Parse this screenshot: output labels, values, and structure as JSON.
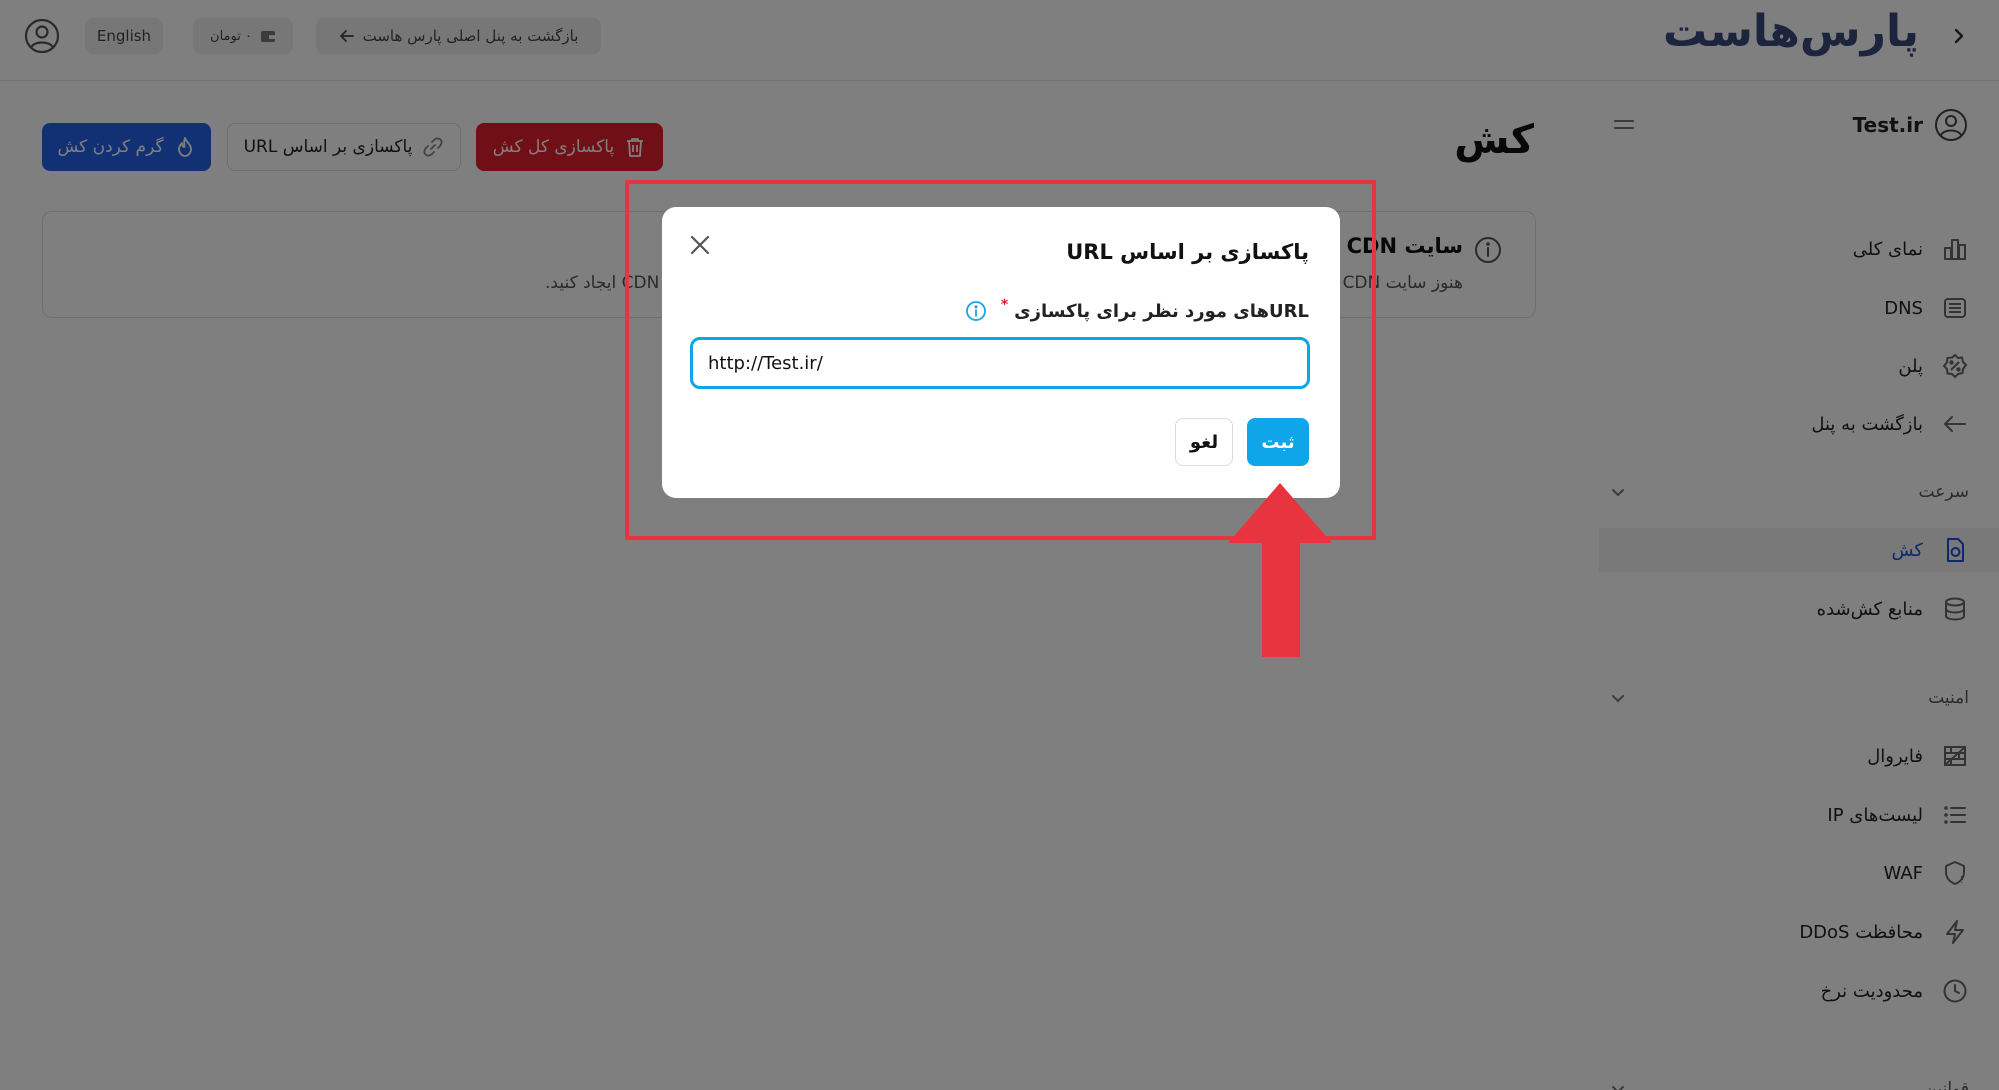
{
  "header": {
    "logo_text": "پارس‌هاست",
    "language_label": "English",
    "balance_label": "۰ تومان",
    "back_to_main_panel": "بازگشت به پنل اصلی پارس هاست"
  },
  "sidebar": {
    "user_domain": "Test.ir",
    "items": [
      {
        "label": "نمای کلی",
        "icon": "chart-icon"
      },
      {
        "label": "DNS",
        "icon": "list-box-icon"
      },
      {
        "label": "پلن",
        "icon": "percent-badge-icon"
      },
      {
        "label": "بازگشت به پنل",
        "icon": "arrow-left-icon"
      }
    ],
    "section_speed": "سرعت",
    "speed_items": [
      {
        "label": "کش",
        "icon": "cache-file-icon"
      },
      {
        "label": "منابع کش‌شده",
        "icon": "database-icon"
      }
    ],
    "section_security": "امنیت",
    "security_items": [
      {
        "label": "فایروال",
        "icon": "firewall-icon"
      },
      {
        "label": "لیست‌های IP",
        "icon": "list-icon"
      },
      {
        "label": "WAF",
        "icon": "shield-alert-icon"
      },
      {
        "label": "محافظت DDoS",
        "icon": "bolt-icon"
      },
      {
        "label": "محدودیت نرخ",
        "icon": "clock-icon"
      }
    ],
    "section_rules": "قوانین"
  },
  "main": {
    "page_title": "کش",
    "buttons": {
      "purge_all": "پاکسازی کل کش",
      "purge_by_url": "پاکسازی بر اساس URL",
      "warm_cache": "گرم کردن کش"
    },
    "info_card": {
      "title": "سایت CDN پیک",
      "desc_right": "هنوز سایت CDN",
      "desc_left": "CDN ایجاد کنید."
    }
  },
  "modal": {
    "title": "پاکسازی بر اساس URL",
    "field_label": "URLهای مورد نظر برای پاکسازی",
    "required_mark": "*",
    "input_value": "http://Test.ir/",
    "submit_label": "ثبت",
    "cancel_label": "لغو"
  },
  "colors": {
    "danger": "#e21f2f",
    "primary": "#2563eb",
    "accent": "#0ea5e9",
    "annotation": "#e8343e"
  }
}
